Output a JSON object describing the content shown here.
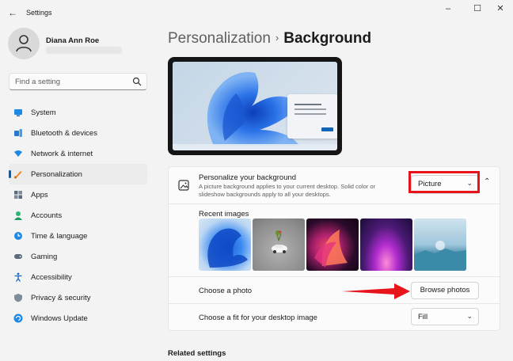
{
  "window": {
    "title": "Settings",
    "back_icon": "back-arrow-icon",
    "controls": [
      "minimize",
      "maximize",
      "close"
    ]
  },
  "profile": {
    "name": "Diana Ann Roe"
  },
  "search": {
    "placeholder": "Find a setting",
    "icon": "search-icon"
  },
  "nav": {
    "items": [
      {
        "label": "System",
        "icon": "system-icon"
      },
      {
        "label": "Bluetooth & devices",
        "icon": "bluetooth-icon"
      },
      {
        "label": "Network & internet",
        "icon": "network-icon"
      },
      {
        "label": "Personalization",
        "icon": "personalization-icon",
        "active": true
      },
      {
        "label": "Apps",
        "icon": "apps-icon"
      },
      {
        "label": "Accounts",
        "icon": "accounts-icon"
      },
      {
        "label": "Time & language",
        "icon": "time-language-icon"
      },
      {
        "label": "Gaming",
        "icon": "gaming-icon"
      },
      {
        "label": "Accessibility",
        "icon": "accessibility-icon"
      },
      {
        "label": "Privacy & security",
        "icon": "privacy-icon"
      },
      {
        "label": "Windows Update",
        "icon": "windows-update-icon"
      }
    ]
  },
  "breadcrumb": {
    "parent": "Personalization",
    "separator": "›",
    "current": "Background"
  },
  "personalize": {
    "title": "Personalize your background",
    "description": "A picture background applies to your current desktop. Solid color or slideshow backgrounds apply to all your desktops.",
    "selected": "Picture"
  },
  "recent": {
    "title": "Recent images"
  },
  "choose_photo": {
    "label": "Choose a photo",
    "button": "Browse photos"
  },
  "fit": {
    "label": "Choose a fit for your desktop image",
    "selected": "Fill"
  },
  "related": {
    "title": "Related settings"
  },
  "colors": {
    "accent": "#005fb8",
    "highlight": "#e8141c",
    "background": "#f3f3f3"
  }
}
